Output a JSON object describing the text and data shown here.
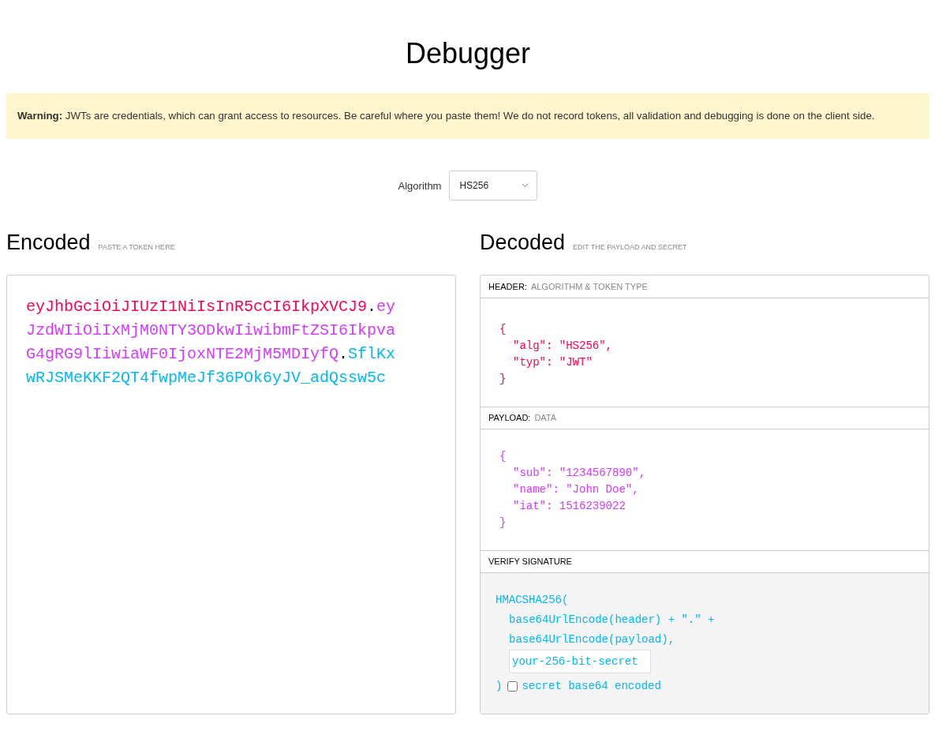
{
  "title": "Debugger",
  "warning": {
    "label": "Warning:",
    "text": "JWTs are credentials, which can grant access to resources. Be careful where you paste them! We do not record tokens, all validation and debugging is done on the client side."
  },
  "algorithm": {
    "label": "Algorithm",
    "value": "HS256"
  },
  "encoded": {
    "title": "Encoded",
    "hint": "PASTE A TOKEN HERE",
    "lines": [
      [
        {
          "kind": "header",
          "text": "eyJhbGciOiJIUzI1NiIsInR5cCI6IkpXVCJ9"
        },
        {
          "kind": "dot",
          "text": "."
        },
        {
          "kind": "payload",
          "text": "ey"
        }
      ],
      [
        {
          "kind": "payload",
          "text": "JzdWIiOiIxMjM0NTY3ODkwIiwibmFtZSI6Ikpva"
        }
      ],
      [
        {
          "kind": "payload",
          "text": "G4gRG9lIiwiaWF0IjoxNTE2MjM5MDIyfQ"
        },
        {
          "kind": "dot",
          "text": "."
        },
        {
          "kind": "signature",
          "text": "SflKx"
        }
      ],
      [
        {
          "kind": "signature",
          "text": "wRJSMeKKF2QT4fwpMeJf36POk6yJV_adQssw5c"
        }
      ]
    ]
  },
  "decoded": {
    "title": "Decoded",
    "hint": "EDIT THE PAYLOAD AND SECRET",
    "sections": [
      {
        "kind": "header",
        "label": "HEADER:",
        "sublabel": "ALGORITHM & TOKEN TYPE",
        "lines": [
          {
            "indent": false,
            "text": "{"
          },
          {
            "indent": true,
            "text": "\"alg\": \"HS256\","
          },
          {
            "indent": true,
            "text": "\"typ\": \"JWT\""
          },
          {
            "indent": false,
            "text": "}"
          }
        ]
      },
      {
        "kind": "payload",
        "label": "PAYLOAD:",
        "sublabel": "DATA",
        "lines": [
          {
            "indent": false,
            "text": "{"
          },
          {
            "indent": true,
            "text": "\"sub\": \"1234567890\","
          },
          {
            "indent": true,
            "text": "\"name\": \"John Doe\","
          },
          {
            "indent": true,
            "text": "\"iat\": 1516239022"
          },
          {
            "indent": false,
            "text": "}"
          }
        ]
      }
    ],
    "signature": {
      "label": "VERIFY SIGNATURE",
      "opening": "HMACSHA256(",
      "lines": [
        "base64UrlEncode(header) + \".\" +",
        "base64UrlEncode(payload),"
      ],
      "secret": "your-256-bit-secret",
      "closing": ")",
      "checkbox": {
        "label": "secret base64 encoded",
        "checked": false
      }
    }
  }
}
